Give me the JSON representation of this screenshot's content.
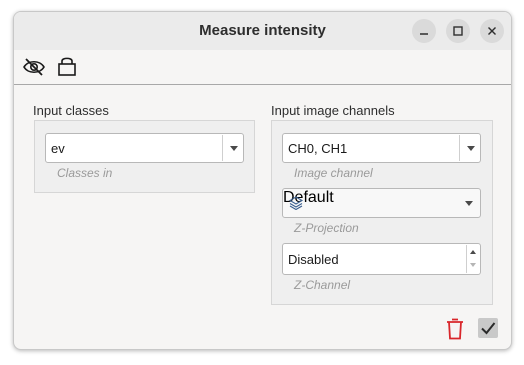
{
  "window": {
    "title": "Measure intensity"
  },
  "toolbar": {
    "icons": [
      "eye-slash-icon",
      "lock-icon"
    ]
  },
  "input_classes": {
    "label": "Input classes",
    "value": "ev",
    "hint": "Classes in"
  },
  "input_channels": {
    "label": "Input image channels",
    "channel_value": "CH0, CH1",
    "channel_hint": "Image channel",
    "projection_value": "Default",
    "projection_hint": "Z-Projection",
    "zchannel_value": "Disabled",
    "zchannel_hint": "Z-Channel"
  },
  "footer": {
    "icons": [
      "trash-icon",
      "check-icon"
    ]
  },
  "colors": {
    "trash": "#d9262b",
    "check_bg": "#c9c9c9",
    "titlebar": "#ebebeb"
  }
}
